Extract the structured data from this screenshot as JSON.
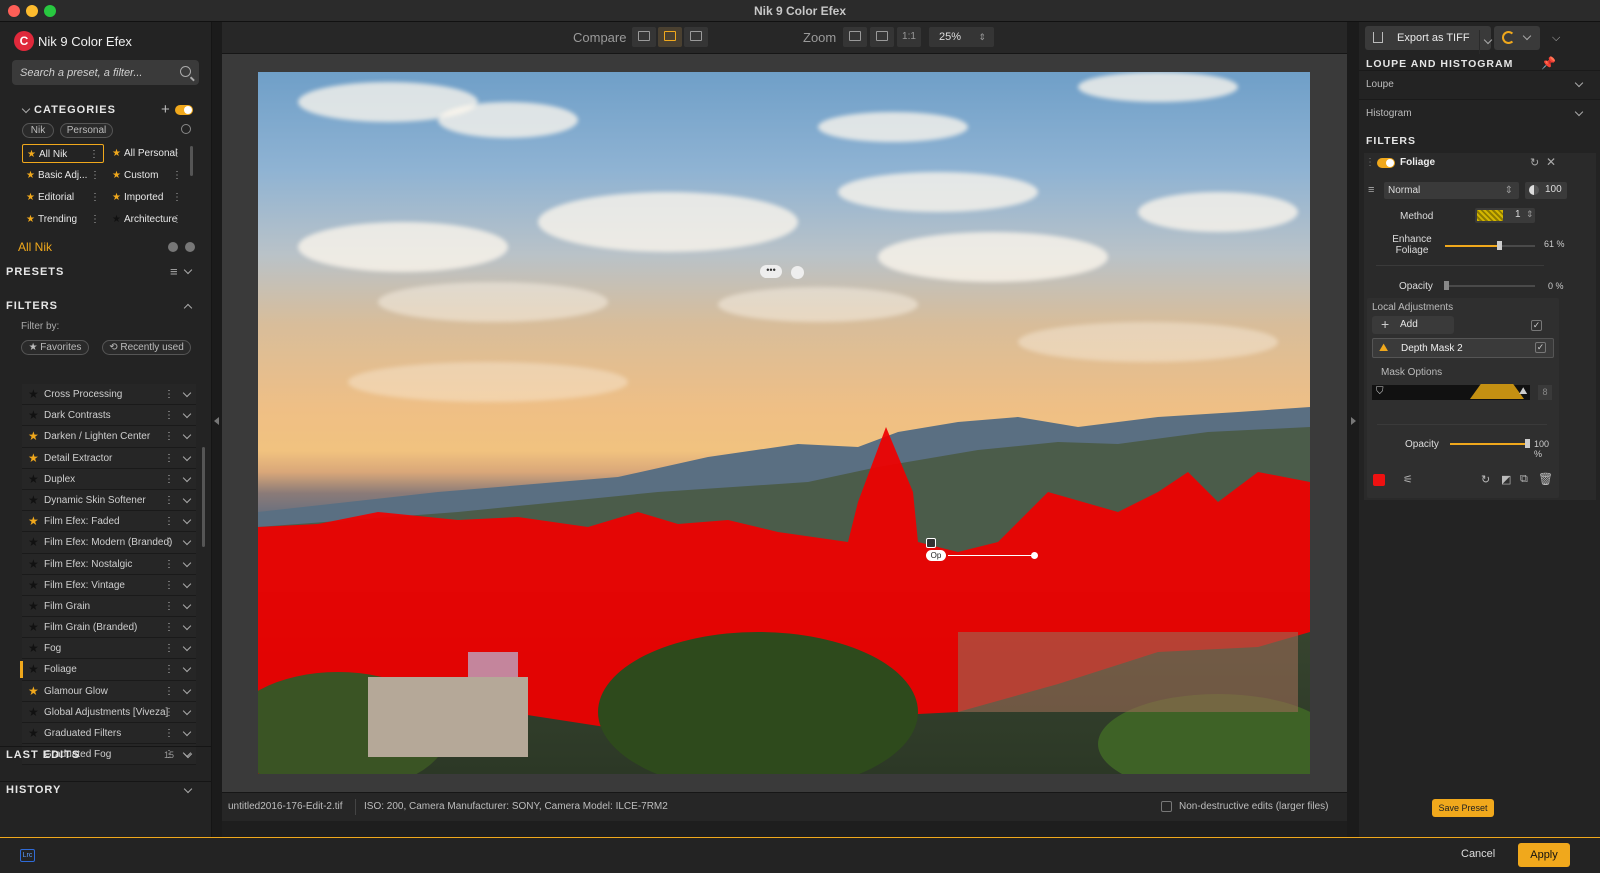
{
  "window": {
    "title": "Nik 9 Color Efex"
  },
  "app": {
    "name": "Nik 9 Color Efex"
  },
  "search": {
    "placeholder": "Search a preset, a filter..."
  },
  "categories": {
    "heading": "CATEGORIES",
    "tags": [
      "Nik",
      "Personal"
    ],
    "left": [
      "All Nik",
      "Basic Adj...",
      "Editorial",
      "Trending"
    ],
    "right": [
      "All Personal",
      "Custom",
      "Imported",
      "Architecture"
    ],
    "current": "All Nik"
  },
  "presets": {
    "heading": "PRESETS"
  },
  "filters_panel": {
    "heading": "FILTERS",
    "filter_by": "Filter by:",
    "favorites": "★ Favorites",
    "recent": "⟲ Recently used",
    "items": [
      {
        "name": "Cross Processing",
        "fav": false
      },
      {
        "name": "Dark Contrasts",
        "fav": false
      },
      {
        "name": "Darken / Lighten Center",
        "fav": true
      },
      {
        "name": "Detail Extractor",
        "fav": true
      },
      {
        "name": "Duplex",
        "fav": false
      },
      {
        "name": "Dynamic Skin Softener",
        "fav": false
      },
      {
        "name": "Film Efex: Faded",
        "fav": true
      },
      {
        "name": "Film Efex: Modern (Branded)",
        "fav": false
      },
      {
        "name": "Film Efex: Nostalgic",
        "fav": false
      },
      {
        "name": "Film Efex: Vintage",
        "fav": false
      },
      {
        "name": "Film Grain",
        "fav": false
      },
      {
        "name": "Film Grain (Branded)",
        "fav": false
      },
      {
        "name": "Fog",
        "fav": false
      },
      {
        "name": "Foliage",
        "fav": false
      },
      {
        "name": "Glamour Glow",
        "fav": true
      },
      {
        "name": "Global Adjustments [Viveza]",
        "fav": false
      },
      {
        "name": "Graduated Filters",
        "fav": false
      },
      {
        "name": "Graduated Fog",
        "fav": false
      }
    ],
    "active": "Foliage"
  },
  "last_edits": {
    "heading": "LAST EDITS",
    "count": "15"
  },
  "history": {
    "heading": "HISTORY"
  },
  "toolbar": {
    "compare": "Compare",
    "zoom": "Zoom",
    "one_to_one": "1:1",
    "zoom_value": "25%"
  },
  "status": {
    "filename": "untitled2016-176-Edit-2.tif",
    "meta": "ISO: 200, Camera Manufacturer: SONY, Camera Model: ILCE-7RM2",
    "nondestructive": "Non-destructive edits (larger files)"
  },
  "right": {
    "export_label": "Export as TIFF",
    "loupe_heading": "LOUPE AND HISTOGRAM",
    "loupe": "Loupe",
    "histogram": "Histogram",
    "filters_heading": "FILTERS",
    "filter_name": "Foliage",
    "blend_mode": "Normal",
    "blend_opacity": "100",
    "method_label": "Method",
    "method_value": "1",
    "enhance_label_1": "Enhance",
    "enhance_label_2": "Foliage",
    "enhance_value": "61 %",
    "enhance_pct": 61,
    "opacity_label": "Opacity",
    "opacity_value": "0 %",
    "local_adj": "Local Adjustments",
    "add": "Add",
    "mask_name": "Depth Mask 2",
    "mask_options": "Mask Options",
    "mask_count": "8",
    "mask_opacity_label": "Opacity",
    "mask_opacity_value": "100 %",
    "save_preset": "Save Preset"
  },
  "canvas_pin": {
    "label": "Op"
  },
  "footer": {
    "cancel": "Cancel",
    "apply": "Apply",
    "badge": "Lrc"
  },
  "colors": {
    "accent": "#f0a81c",
    "mask": "#f00000"
  }
}
